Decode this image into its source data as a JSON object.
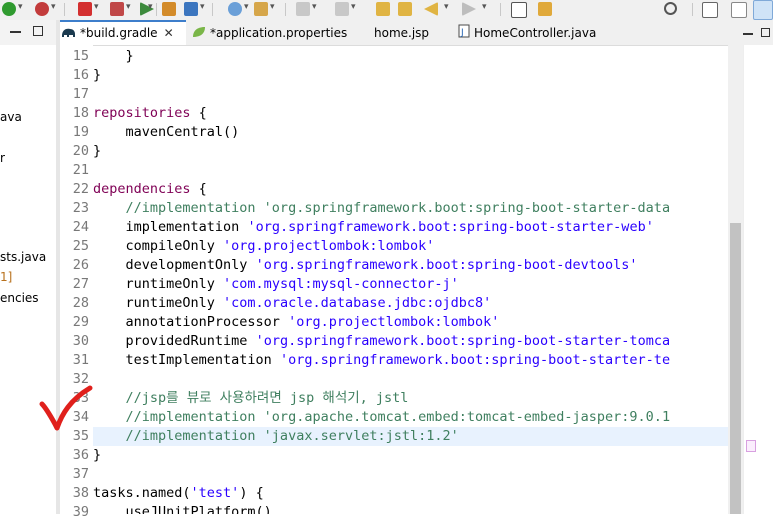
{
  "toolbar": {
    "icons": [
      "run-icon",
      "debug-icon",
      "stop-icon",
      "external-tools-icon",
      "build-icon",
      "new-icon",
      "search-icon",
      "open-type-icon",
      "next-annotation-icon",
      "prev-annotation-icon",
      "back-icon",
      "forward-icon",
      "perspective-icon",
      "quick-access-search-icon",
      "java-perspective-icon",
      "debug-perspective-icon"
    ]
  },
  "left_panel": {
    "items": [
      "ava",
      "r",
      "sts.java",
      "1]",
      "encies"
    ]
  },
  "tabs": [
    {
      "label": "*build.gradle",
      "icon": "gradle-elephant-icon",
      "active": true
    },
    {
      "label": "*application.properties",
      "icon": "spring-leaf-icon",
      "active": false
    },
    {
      "label": "home.jsp",
      "icon": "",
      "active": false
    },
    {
      "label": "HomeController.java",
      "icon": "java-file-icon",
      "active": false
    }
  ],
  "code": {
    "highlighted_line": 35,
    "lines": [
      {
        "n": "15",
        "segs": [
          {
            "t": "    }",
            "c": ""
          }
        ]
      },
      {
        "n": "16",
        "segs": [
          {
            "t": "}",
            "c": ""
          }
        ]
      },
      {
        "n": "17",
        "segs": [
          {
            "t": "",
            "c": ""
          }
        ]
      },
      {
        "n": "18",
        "segs": [
          {
            "t": "repositories",
            "c": "kw"
          },
          {
            "t": " {",
            "c": ""
          }
        ]
      },
      {
        "n": "19",
        "segs": [
          {
            "t": "    mavenCentral()",
            "c": ""
          }
        ]
      },
      {
        "n": "20",
        "segs": [
          {
            "t": "}",
            "c": ""
          }
        ]
      },
      {
        "n": "21",
        "segs": [
          {
            "t": "",
            "c": ""
          }
        ]
      },
      {
        "n": "22",
        "segs": [
          {
            "t": "dependencies",
            "c": "kw"
          },
          {
            "t": " {",
            "c": ""
          }
        ]
      },
      {
        "n": "23",
        "segs": [
          {
            "t": "    //implementation 'org.springframework.boot:spring-boot-starter-data",
            "c": "cmt"
          }
        ]
      },
      {
        "n": "24",
        "segs": [
          {
            "t": "    implementation ",
            "c": ""
          },
          {
            "t": "'org.springframework.boot:spring-boot-starter-web'",
            "c": "str"
          }
        ]
      },
      {
        "n": "25",
        "segs": [
          {
            "t": "    compileOnly ",
            "c": ""
          },
          {
            "t": "'org.projectlombok:lombok'",
            "c": "str"
          }
        ]
      },
      {
        "n": "26",
        "segs": [
          {
            "t": "    developmentOnly ",
            "c": ""
          },
          {
            "t": "'org.springframework.boot:spring-boot-devtools'",
            "c": "str"
          }
        ]
      },
      {
        "n": "27",
        "segs": [
          {
            "t": "    runtimeOnly ",
            "c": ""
          },
          {
            "t": "'com.mysql:mysql-connector-j'",
            "c": "str"
          }
        ]
      },
      {
        "n": "28",
        "segs": [
          {
            "t": "    runtimeOnly ",
            "c": ""
          },
          {
            "t": "'com.oracle.database.jdbc:ojdbc8'",
            "c": "str"
          }
        ]
      },
      {
        "n": "29",
        "segs": [
          {
            "t": "    annotationProcessor ",
            "c": ""
          },
          {
            "t": "'org.projectlombok:lombok'",
            "c": "str"
          }
        ]
      },
      {
        "n": "30",
        "segs": [
          {
            "t": "    providedRuntime ",
            "c": ""
          },
          {
            "t": "'org.springframework.boot:spring-boot-starter-tomca",
            "c": "str"
          }
        ]
      },
      {
        "n": "31",
        "segs": [
          {
            "t": "    testImplementation ",
            "c": ""
          },
          {
            "t": "'org.springframework.boot:spring-boot-starter-te",
            "c": "str"
          }
        ]
      },
      {
        "n": "32",
        "segs": [
          {
            "t": "",
            "c": ""
          }
        ]
      },
      {
        "n": "33",
        "segs": [
          {
            "t": "    //jsp를 뷰로 사용하려면 jsp 해석기, jstl",
            "c": "cmt"
          }
        ]
      },
      {
        "n": "34",
        "segs": [
          {
            "t": "    //implementation 'org.apache.tomcat.embed:tomcat-embed-jasper:9.0.1",
            "c": "cmt"
          }
        ]
      },
      {
        "n": "35",
        "segs": [
          {
            "t": "    //implementation 'javax.servlet:jstl:1.2'",
            "c": "cmt"
          }
        ]
      },
      {
        "n": "36",
        "segs": [
          {
            "t": "}",
            "c": ""
          }
        ]
      },
      {
        "n": "37",
        "segs": [
          {
            "t": "",
            "c": ""
          }
        ]
      },
      {
        "n": "38",
        "segs": [
          {
            "t": "tasks.named(",
            "c": ""
          },
          {
            "t": "'test'",
            "c": "str"
          },
          {
            "t": ") {",
            "c": ""
          }
        ]
      },
      {
        "n": "39",
        "segs": [
          {
            "t": "    useJUnitPlatform()",
            "c": ""
          }
        ]
      }
    ]
  },
  "annotation": {
    "mark": "red-checkmark-icon",
    "color": "#e0201c"
  },
  "colors": {
    "keyword": "#7f0055",
    "string": "#2a00ff",
    "comment": "#3f7f5f",
    "active_tab_accent": "#3d7ecb",
    "line_highlight": "#e8f2fe"
  }
}
